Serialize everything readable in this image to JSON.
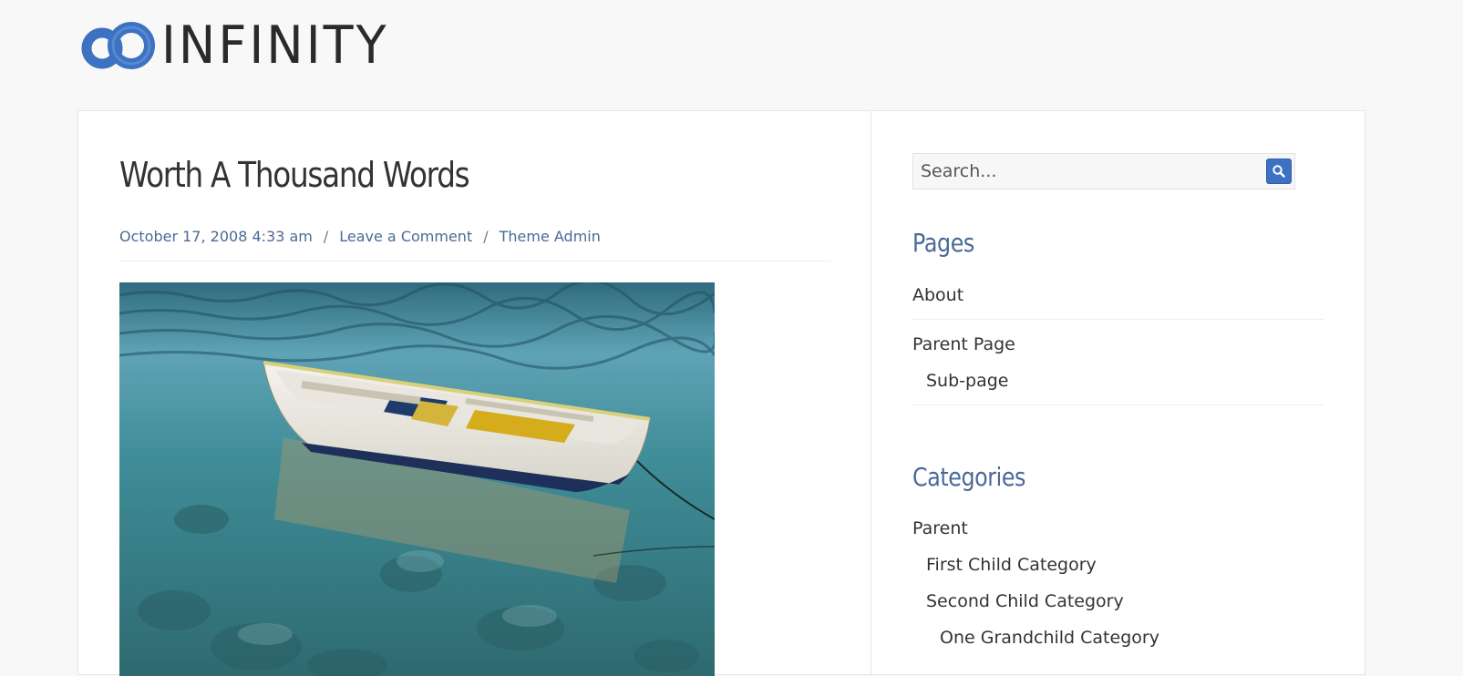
{
  "site": {
    "logo_text": "INFINITY",
    "logo_icon": "infinity-rings-icon",
    "brand_color": "#3d72c2"
  },
  "post": {
    "title": "Worth A Thousand Words",
    "date": "October 17, 2008 4:33 am",
    "comments_link": "Leave a Comment",
    "author": "Theme Admin",
    "separator": "/",
    "image": "boat-on-clear-water-photo"
  },
  "sidebar": {
    "search_placeholder": "Search...",
    "search_icon": "magnifier-icon",
    "pages": {
      "title": "Pages",
      "items": [
        {
          "label": "About"
        },
        {
          "label": "Parent Page"
        },
        {
          "label": "Sub-page"
        }
      ]
    },
    "categories": {
      "title": "Categories",
      "items": [
        {
          "label": "Parent"
        },
        {
          "label": "First Child Category"
        },
        {
          "label": "Second Child Category"
        },
        {
          "label": "One Grandchild Category"
        }
      ]
    }
  },
  "colors": {
    "link": "#4a6a96",
    "text": "#333333",
    "page_bg": "#f8f8f8"
  }
}
